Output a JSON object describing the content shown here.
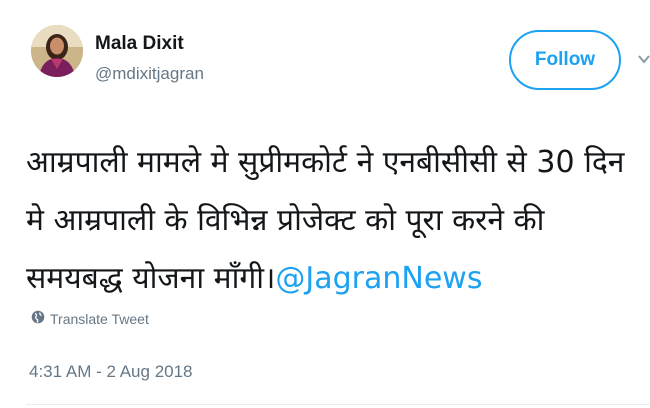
{
  "user": {
    "name": "Mala Dixit",
    "handle": "@mdixitjagran"
  },
  "follow_label": "Follow",
  "tweet": {
    "text": "आम्रपाली मामले मे सुप्रीमकोर्ट ने एनबीसीसी से 30 दिन मे आम्रपाली के विभिन्न प्रोजेक्ट को पूरा करने की समयबद्ध योजना माँगी।",
    "mention": "@JagranNews"
  },
  "translate_label": "Translate Tweet",
  "timestamp": "4:31 AM - 2 Aug 2018",
  "colors": {
    "accent": "#1da1f2",
    "secondary_text": "#657786",
    "primary_text": "#14171a"
  },
  "icons": {
    "translate": "globe-icon",
    "menu": "chevron-down-icon"
  }
}
